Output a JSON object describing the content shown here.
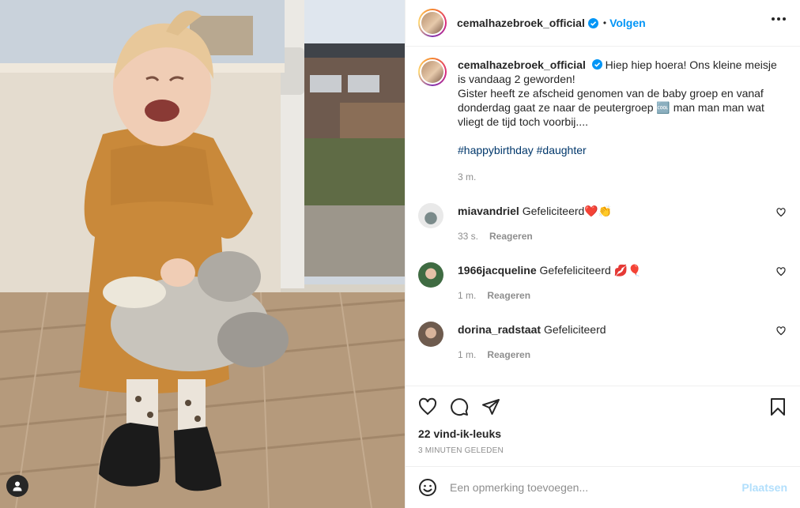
{
  "post": {
    "username": "cemalhazebroek_official",
    "follow_label": "Volgen",
    "dot": "•",
    "caption_line1": "Hiep hiep hoera! Ons kleine meisje is vandaag 2 geworden!",
    "caption_line2": "Gister heeft ze afscheid genomen van de baby groep en vanaf donderdag gaat ze naar de peutergroep 🆒 man man man wat vliegt de tijd toch voorbij....",
    "hashtags": "#happybirthday #daughter",
    "caption_time": "3 m."
  },
  "comments": [
    {
      "user": "miavandriel",
      "text": "Gefeliciteerd❤️👏",
      "time": "33 s.",
      "reply": "Reageren",
      "avatar_color": "#d7d7d7"
    },
    {
      "user": "1966jacqueline",
      "text": "Gefefeliciteerd 💋🎈",
      "time": "1 m.",
      "reply": "Reageren",
      "avatar_color": "#4f7a4d"
    },
    {
      "user": "dorina_radstaat",
      "text": "Gefeliciteerd",
      "time": "1 m.",
      "reply": "Reageren",
      "avatar_color": "#8a7565"
    }
  ],
  "stats": {
    "likes": "22 vind-ik-leuks",
    "posted_ago": "3 MINUTEN GELEDEN"
  },
  "comment_box": {
    "placeholder": "Een opmerking toevoegen...",
    "post_label": "Plaatsen"
  },
  "icons": {
    "verified": "verified-badge-icon",
    "more": "more-options-icon",
    "like": "heart-icon",
    "comment": "comment-bubble-icon",
    "share": "paper-plane-icon",
    "save": "bookmark-icon",
    "emoji": "emoji-icon",
    "tag": "user-tag-icon"
  },
  "colors": {
    "accent": "#0095f6",
    "hashtag": "#00376b",
    "muted": "#8e8e8e",
    "post_disabled": "#b2dffc"
  }
}
